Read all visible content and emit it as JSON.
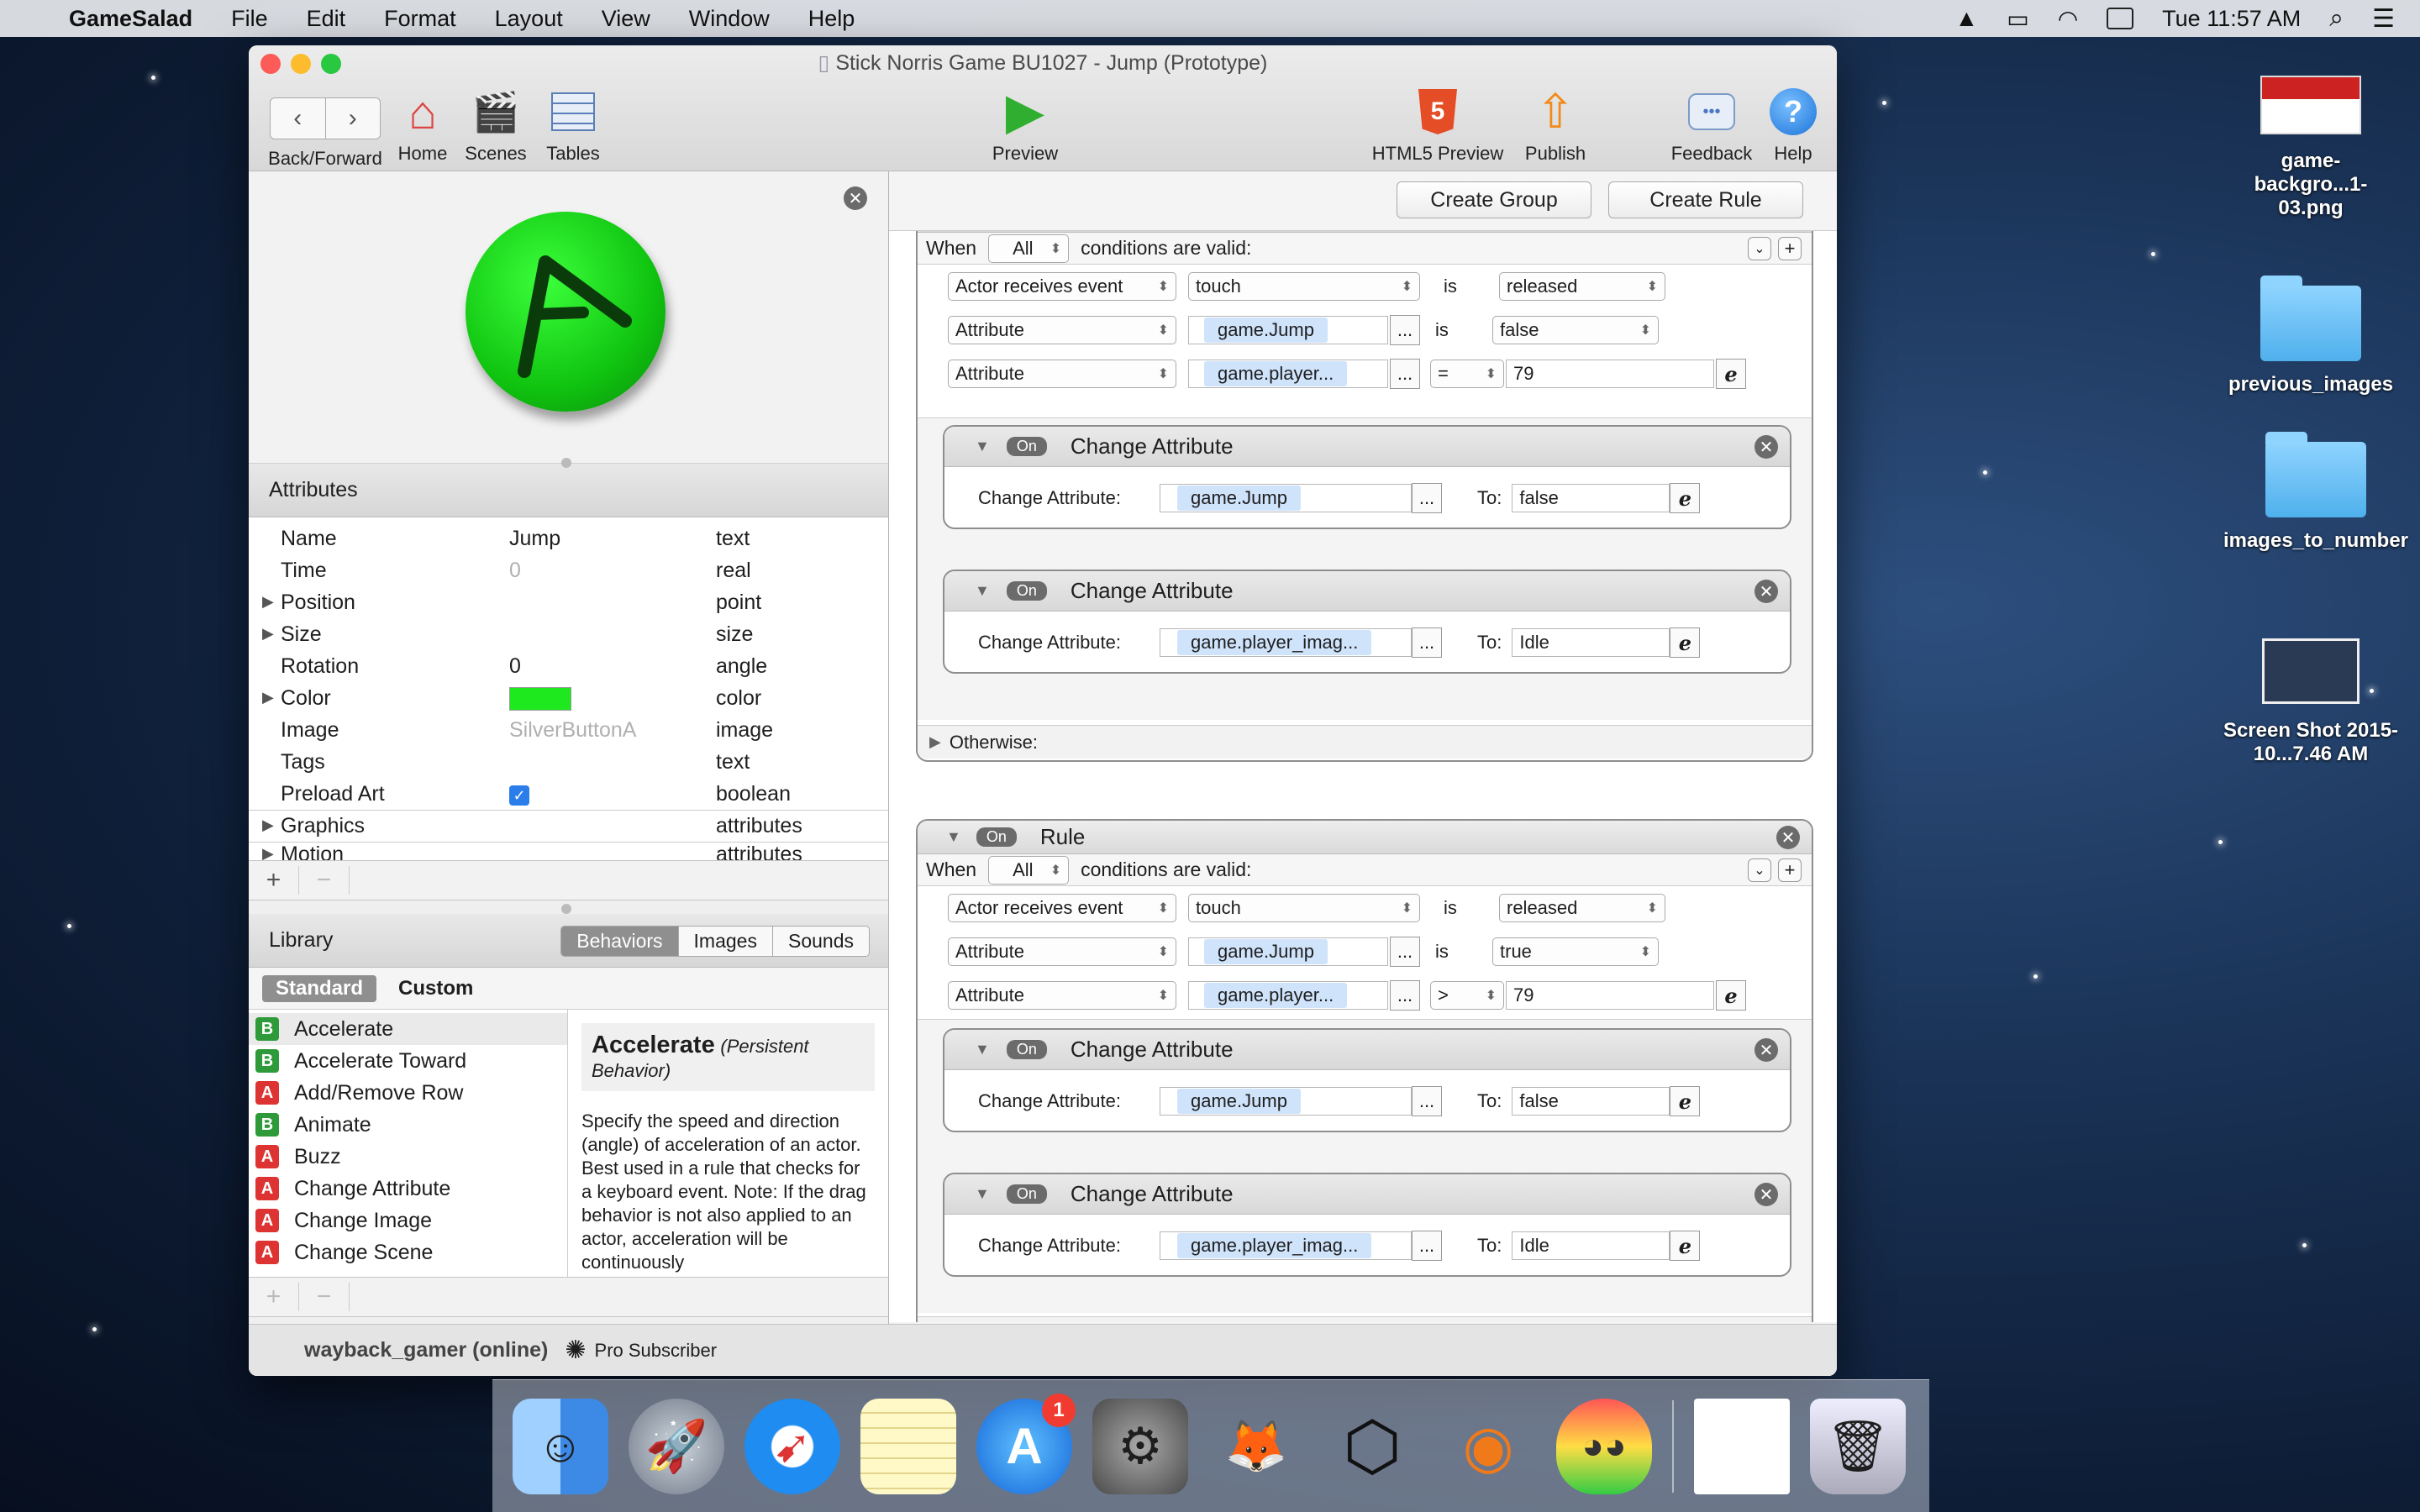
{
  "menubar": {
    "app_name": "GameSalad",
    "items": [
      "File",
      "Edit",
      "Format",
      "Layout",
      "View",
      "Window",
      "Help"
    ],
    "clock": "Tue 11:57 AM"
  },
  "window": {
    "title": "Stick Norris Game BU1027 - Jump (Prototype)",
    "toolbar": {
      "back_forward": "Back/Forward",
      "home": "Home",
      "scenes": "Scenes",
      "tables": "Tables",
      "preview": "Preview",
      "html5_preview": "HTML5 Preview",
      "publish": "Publish",
      "feedback": "Feedback",
      "help": "Help"
    }
  },
  "attributes": {
    "title": "Attributes",
    "rows": [
      {
        "name": "Name",
        "value": "Jump",
        "type": "text"
      },
      {
        "name": "Time",
        "value": "0",
        "type": "real"
      },
      {
        "name": "Position",
        "value": "",
        "type": "point"
      },
      {
        "name": "Size",
        "value": "",
        "type": "size"
      },
      {
        "name": "Rotation",
        "value": "0",
        "type": "angle"
      },
      {
        "name": "Color",
        "value": "",
        "type": "color"
      },
      {
        "name": "Image",
        "value": "SilverButtonA",
        "type": "image"
      },
      {
        "name": "Tags",
        "value": "",
        "type": "text"
      },
      {
        "name": "Preload Art",
        "value": "",
        "type": "boolean"
      }
    ],
    "groups": [
      {
        "name": "Graphics",
        "type": "attributes"
      },
      {
        "name": "Motion",
        "type": "attributes"
      }
    ],
    "color_value": "#1ee81e"
  },
  "library": {
    "title": "Library",
    "tabs": [
      "Behaviors",
      "Images",
      "Sounds"
    ],
    "subtabs": [
      "Standard",
      "Custom"
    ],
    "items": [
      {
        "badge": "B",
        "label": "Accelerate"
      },
      {
        "badge": "B",
        "label": "Accelerate Toward"
      },
      {
        "badge": "A",
        "label": "Add/Remove Row"
      },
      {
        "badge": "B",
        "label": "Animate"
      },
      {
        "badge": "A",
        "label": "Buzz"
      },
      {
        "badge": "A",
        "label": "Change Attribute"
      },
      {
        "badge": "A",
        "label": "Change Image"
      },
      {
        "badge": "A",
        "label": "Change Scene"
      }
    ],
    "desc_title": "Accelerate",
    "desc_sub": "(Persistent Behavior)",
    "desc_text": "Specify the speed and direction (angle) of acceleration of an actor. Best used in a rule that checks for a keyboard event. Note: If the drag behavior is not also applied to an actor, acceleration will be continuously"
  },
  "status": {
    "user": "wayback_gamer (online)",
    "subscription": "Pro Subscriber"
  },
  "editor": {
    "create_group": "Create Group",
    "create_rule": "Create Rule",
    "on_label": "On",
    "rule_label": "Rule",
    "when": "When",
    "all": "All",
    "conditions_valid": "conditions are valid:",
    "is": "is",
    "change_attribute_title": "Change Attribute",
    "change_attribute_label": "Change Attribute:",
    "to": "To:",
    "otherwise": "Otherwise:",
    "dots": "...",
    "rule1": {
      "cond1": {
        "type": "Actor receives event",
        "event": "touch",
        "state": "released"
      },
      "cond2": {
        "type": "Attribute",
        "attr": "game.Jump",
        "value": "false"
      },
      "cond3": {
        "type": "Attribute",
        "attr": "game.player...",
        "op": "=",
        "value": "79"
      },
      "b1": {
        "attr": "game.Jump",
        "to": "false"
      },
      "b2": {
        "attr": "game.player_imag...",
        "to": "Idle"
      }
    },
    "rule2": {
      "cond1": {
        "type": "Actor receives event",
        "event": "touch",
        "state": "released"
      },
      "cond2": {
        "type": "Attribute",
        "attr": "game.Jump",
        "value": "true"
      },
      "cond3": {
        "type": "Attribute",
        "attr": "game.player...",
        "op": ">",
        "value": "79"
      },
      "b1": {
        "attr": "game.Jump",
        "to": "false"
      },
      "b2": {
        "attr": "game.player_imag...",
        "to": "Idle"
      }
    }
  },
  "desktop": {
    "icons": [
      {
        "label": "game-backgro...1-03.png"
      },
      {
        "label": "previous_images"
      },
      {
        "label": "images_to_number"
      },
      {
        "label": "Screen Shot 2015-10...7.46 AM"
      }
    ]
  },
  "dock": {
    "appstore_badge": "1"
  }
}
